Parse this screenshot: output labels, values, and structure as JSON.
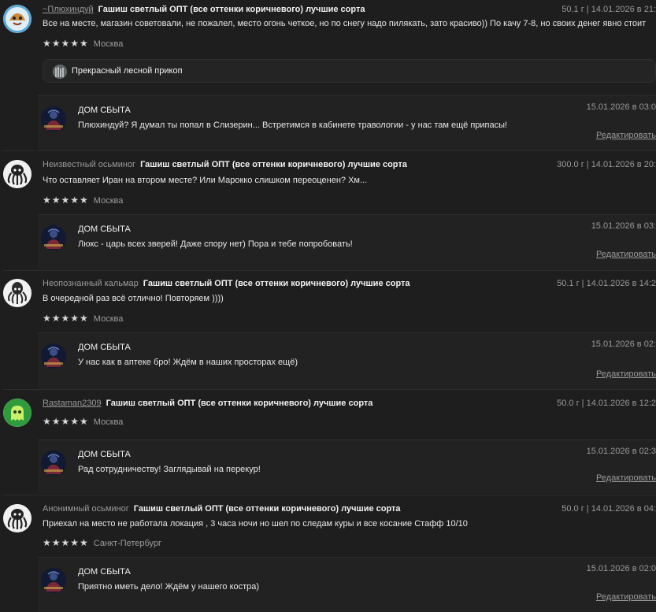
{
  "reviews": [
    {
      "author": "~Плюхиндуй",
      "author_link": true,
      "avatar": "cartoon-avatar",
      "product": "Гашиш светлый ОПТ (все оттенки коричневого) лучшие сорта",
      "meta": "50.1 г | 14.01.2026 в 21:",
      "text": "Все на месте, магазин советовали, не пожалел, место огонь четкое, но по снегу надо пилякать, зато красиво)) По качу 7-8, но своих денег явно стоит",
      "stars": "★★★★★",
      "city": "Москва",
      "chip": "Прекрасный лесной прикоп",
      "reply": {
        "name": "ДОМ СБЫТА",
        "date": "15.01.2026 в 03:0",
        "text": "Плюхиндуй? Я думал ты попал в Слизерин... Встретимся в кабинете травологии - у нас там ещё припасы!",
        "edit": "Редактировать"
      }
    },
    {
      "author": "Неизвестный осьминог",
      "author_link": false,
      "avatar": "octopus-avatar",
      "product": "Гашиш светлый ОПТ (все оттенки коричневого) лучшие сорта",
      "meta": "300.0 г | 14.01.2026 в 20:",
      "text": "Что оставляет Иран на втором месте? Или Марокко слишком переоценен? Хм...",
      "stars": "★★★★★",
      "city": "Москва",
      "reply": {
        "name": "ДОМ СБЫТА",
        "date": "15.01.2026 в 03:",
        "text": "Люкс - царь всех зверей! Даже спору нет) Пора и тебе попробовать!",
        "edit": "Редактировать"
      }
    },
    {
      "author": "Неопознанный кальмар",
      "author_link": false,
      "avatar": "squid-avatar",
      "product": "Гашиш светлый ОПТ (все оттенки коричневого) лучшие сорта",
      "meta": "50.1 г | 14.01.2026 в 14:2",
      "text": "В очередной раз всё отлично! Повторяем ))))",
      "stars": "★★★★★",
      "city": "Москва",
      "reply": {
        "name": "ДОМ СБЫТА",
        "date": "15.01.2026 в 02:",
        "text": "У нас как в аптеке бро! Ждём в наших просторах ещё)",
        "edit": "Редактировать"
      }
    },
    {
      "author": "Rastaman2309",
      "author_link": true,
      "avatar": "ghost-avatar",
      "product": "Гашиш светлый ОПТ (все оттенки коричневого) лучшие сорта",
      "meta": "50.0 г | 14.01.2026 в 12:2",
      "text": "",
      "stars": "★★★★★",
      "city": "Москва",
      "reply": {
        "name": "ДОМ СБЫТА",
        "date": "15.01.2026 в 02:3",
        "text": "Рад сотрудничеству! Заглядывай на перекур!",
        "edit": "Редактировать"
      }
    },
    {
      "author": "Анонимный осьминог",
      "author_link": false,
      "avatar": "octopus-avatar",
      "product": "Гашиш светлый ОПТ (все оттенки коричневого) лучшие сорта",
      "meta": "50.0 г | 14.01.2026 в 04:",
      "text": "Приехал на место не работала локация , 3 часа ночи но шел по следам куры и все косание Стафф 10/10",
      "stars": "★★★★★",
      "city": "Санкт-Петербург",
      "reply": {
        "name": "ДОМ СБЫТА",
        "date": "15.01.2026 в 02:0",
        "text": "Приятно иметь дело! Ждём у нашего костра)",
        "edit": "Редактировать"
      }
    }
  ]
}
